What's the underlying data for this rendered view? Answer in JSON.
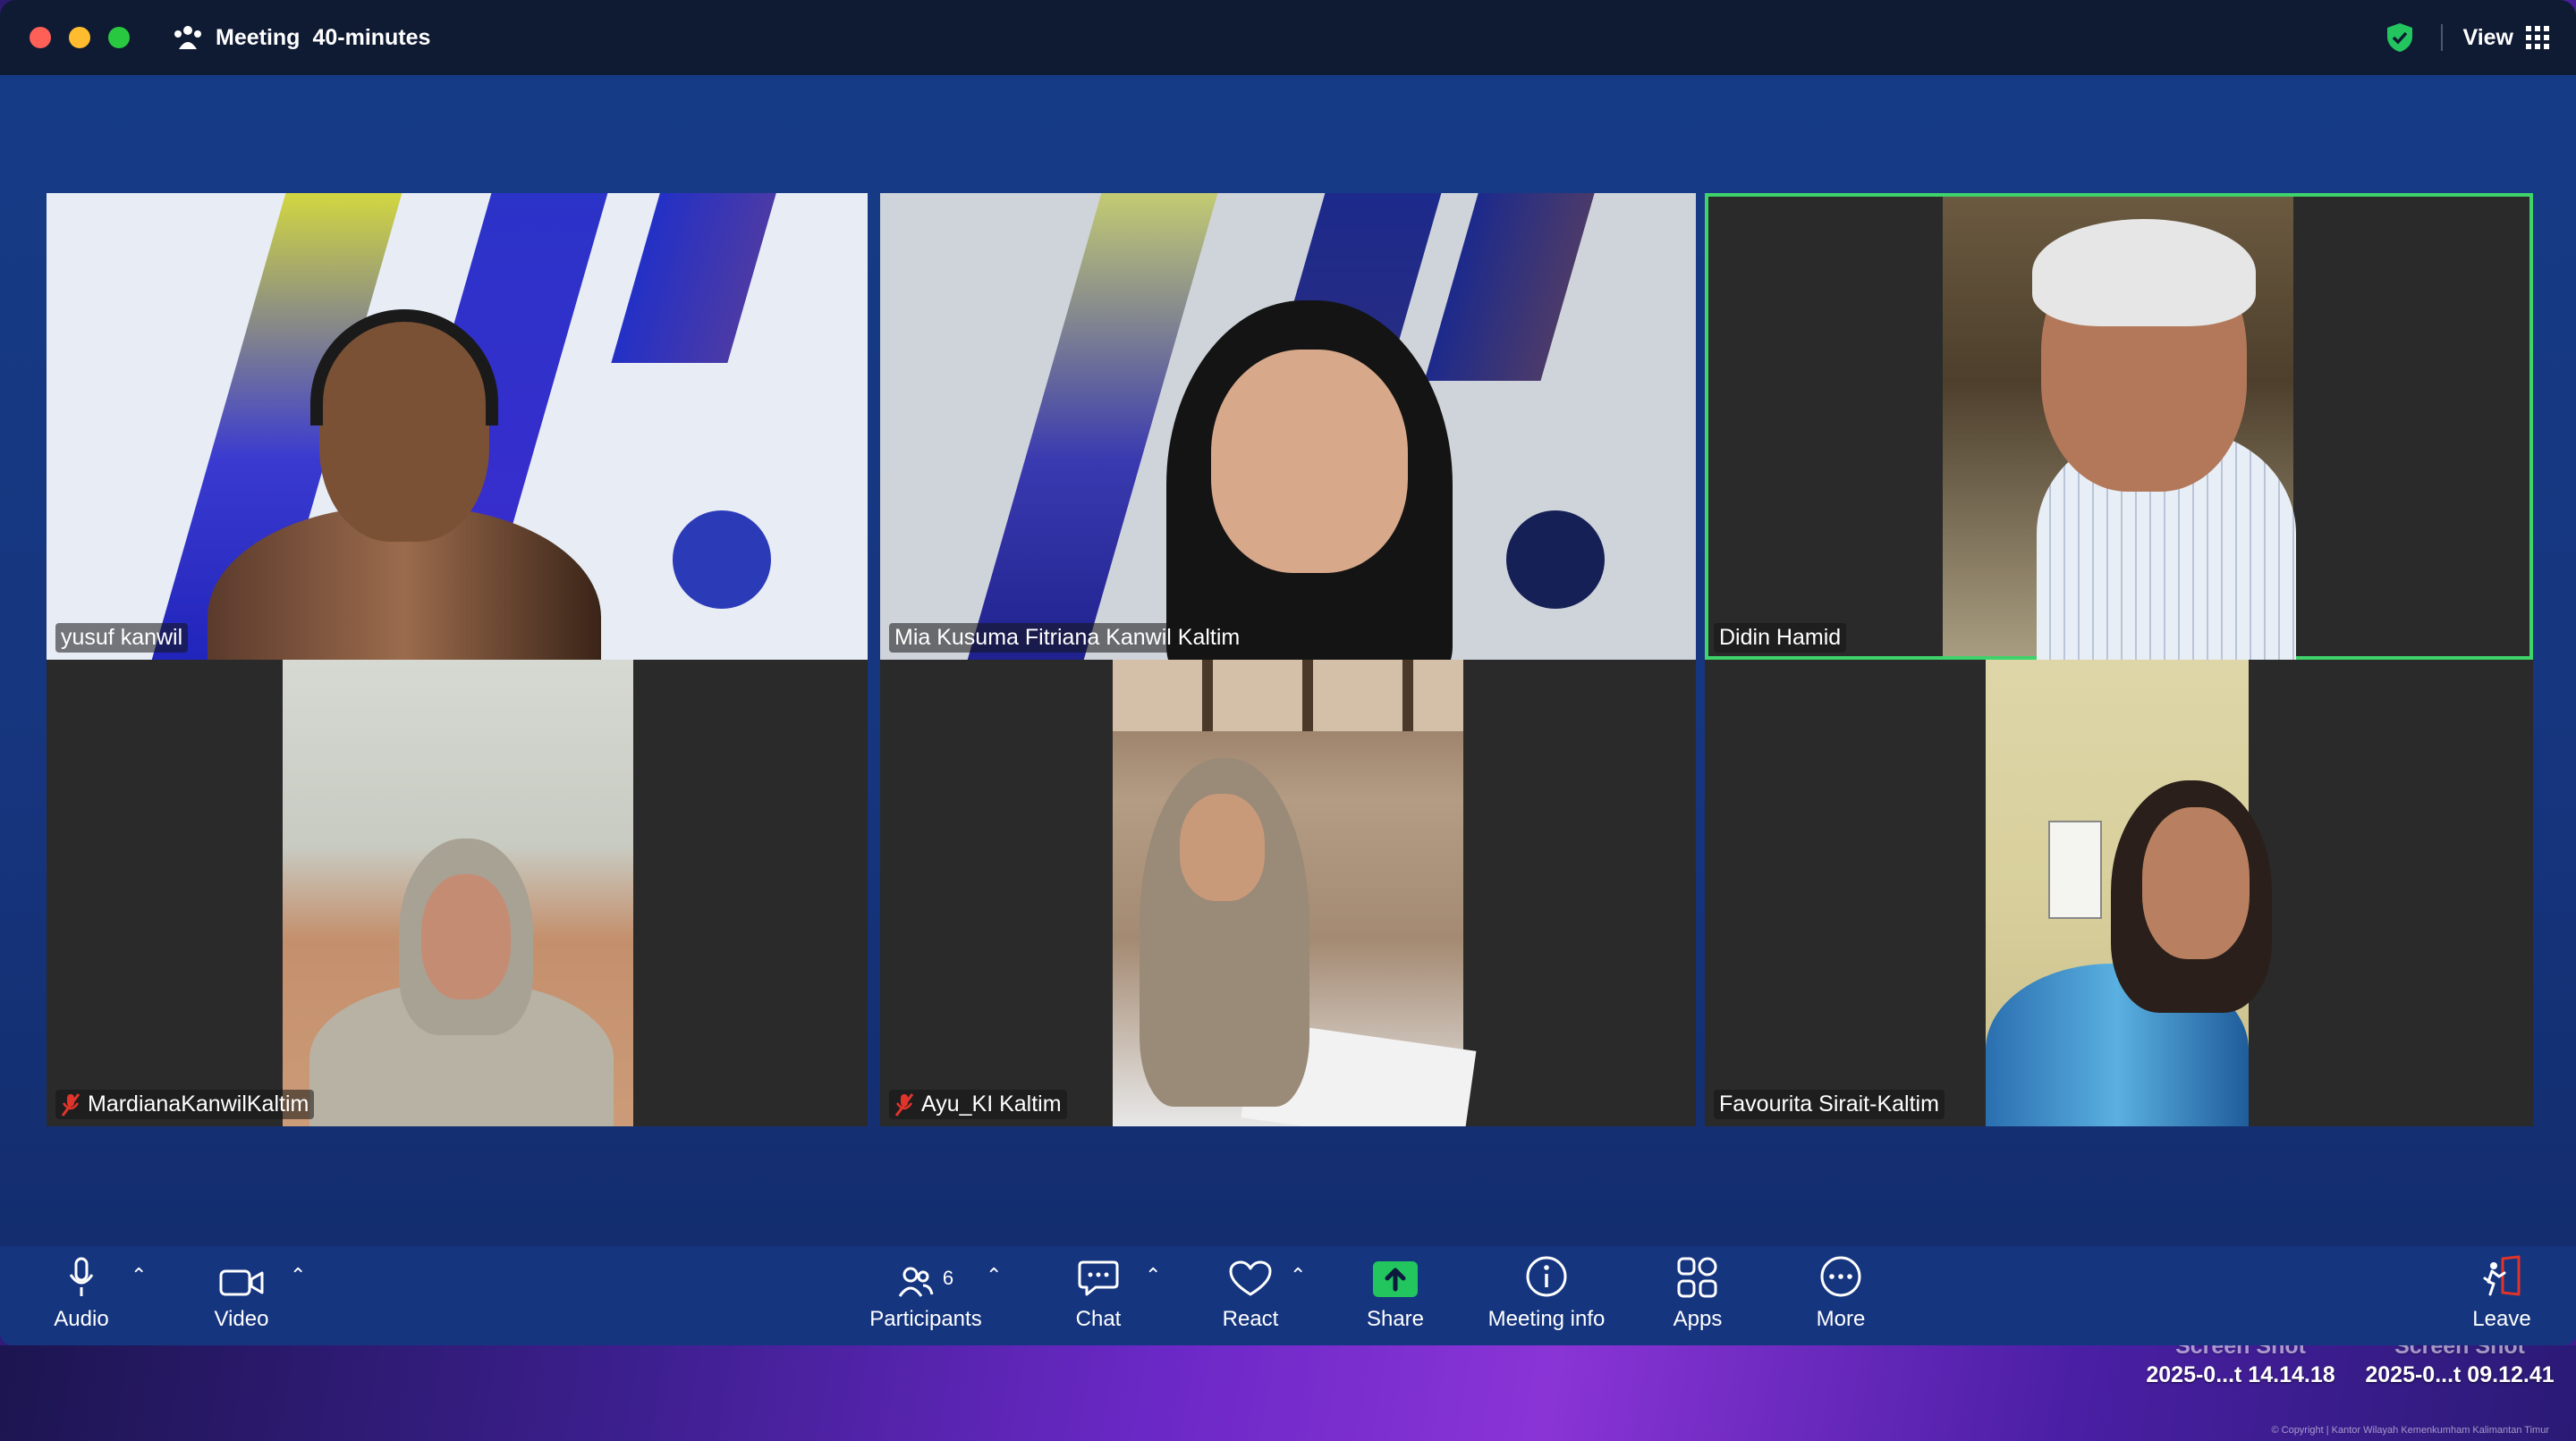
{
  "window": {
    "title": "Meeting",
    "subtitle": "40-minutes",
    "view_label": "View"
  },
  "participants": [
    {
      "name": "yusuf kanwil",
      "muted": false,
      "active": false
    },
    {
      "name": "Mia Kusuma Fitriana Kanwil Kaltim",
      "muted": false,
      "active": false
    },
    {
      "name": "Didin Hamid",
      "muted": false,
      "active": true
    },
    {
      "name": "MardianaKanwilKaltim",
      "muted": true,
      "active": false
    },
    {
      "name": "Ayu_KI Kaltim",
      "muted": true,
      "active": false
    },
    {
      "name": "Favourita Sirait-Kaltim",
      "muted": false,
      "active": false
    }
  ],
  "toolbar": {
    "audio": "Audio",
    "video": "Video",
    "participants": "Participants",
    "participants_count": "6",
    "chat": "Chat",
    "react": "React",
    "share": "Share",
    "meeting_info": "Meeting info",
    "apps": "Apps",
    "more": "More",
    "leave": "Leave"
  },
  "desktop": {
    "file1_line1": "Screen Shot",
    "file1_line2": "2025-0...t 14.14.18",
    "file2_line1": "Screen Shot",
    "file2_line2": "2025-0...t 09.12.41",
    "copyright": "© Copyright | Kantor Wilayah Kemenkumham Kalimantan Timur"
  },
  "colors": {
    "accent_active": "#3fd36b",
    "share_green": "#22c55e",
    "muted_red": "#e0342b",
    "toolbar_bg": "#15357f",
    "titlebar_bg": "#0f1a33"
  }
}
